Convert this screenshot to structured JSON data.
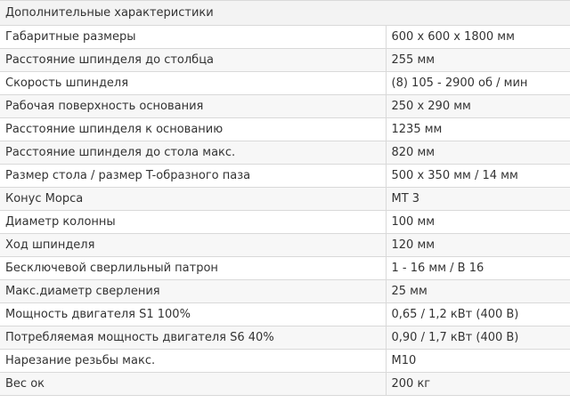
{
  "table": {
    "heading": "Дополнительные характеристики",
    "rows": [
      {
        "label": "Габаритные размеры",
        "value": "600 x 600 x 1800 мм"
      },
      {
        "label": "Расстояние шпинделя до столбца",
        "value": "255 мм"
      },
      {
        "label": "Скорость шпинделя",
        "value": "(8) 105 - 2900 об / мин"
      },
      {
        "label": "Рабочая поверхность основания",
        "value": "250 x 290 мм"
      },
      {
        "label": "Расстояние шпинделя к основанию",
        "value": "1235 мм"
      },
      {
        "label": "Расстояние шпинделя до стола макс.",
        "value": "820 мм"
      },
      {
        "label": "Размер стола / размер T-образного паза",
        "value": "500 x 350 мм / 14 мм"
      },
      {
        "label": "Конус Морса",
        "value": "MT 3"
      },
      {
        "label": "Диаметр колонны",
        "value": "100 мм"
      },
      {
        "label": "Ход шпинделя",
        "value": "120 мм"
      },
      {
        "label": "Бесключевой сверлильный патрон",
        "value": "1 - 16 мм / B 16"
      },
      {
        "label": "Макс.диаметр сверления",
        "value": "25 мм"
      },
      {
        "label": "Мощность двигателя S1 100%",
        "value": "0,65 / 1,2 кВт (400 В)"
      },
      {
        "label": "Потребляемая мощность двигателя S6 40%",
        "value": "0,90 / 1,7 кВт (400 В)"
      },
      {
        "label": "Нарезание резьбы макс.",
        "value": "M10"
      },
      {
        "label": "Вес ок",
        "value": "200 кг"
      }
    ]
  }
}
